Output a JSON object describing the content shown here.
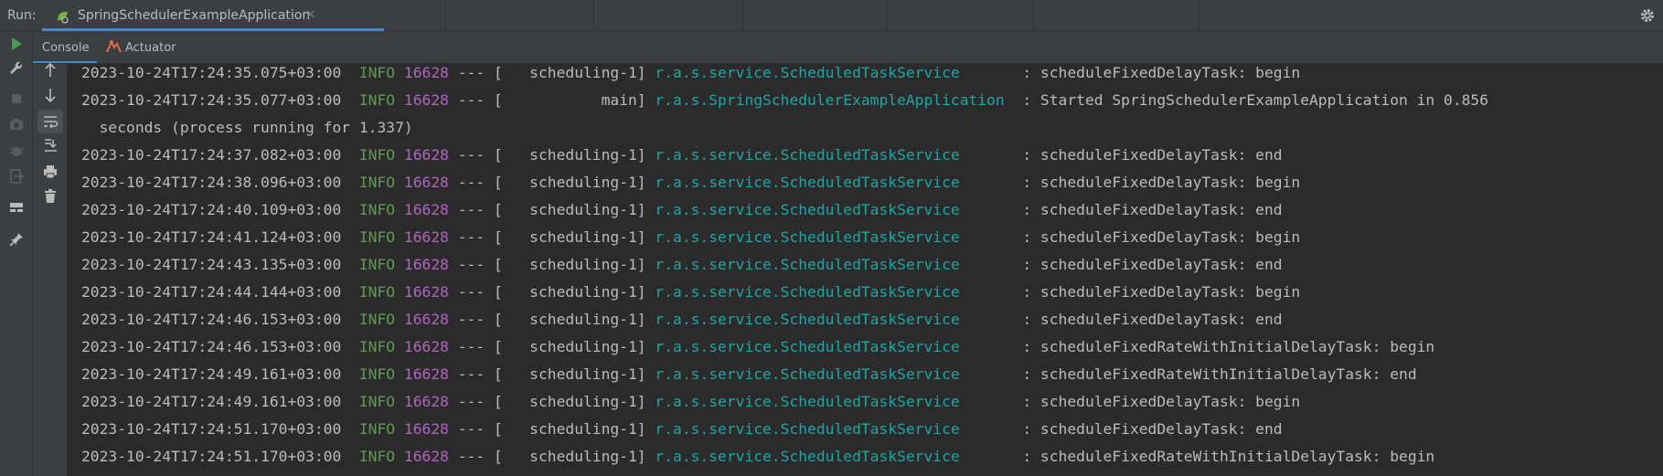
{
  "header": {
    "run_label": "Run:",
    "tab_title": "SpringSchedulerExampleApplication",
    "tab_close": "×"
  },
  "subtabs": [
    {
      "label": "Console",
      "active": true
    },
    {
      "label": "Actuator",
      "active": false
    }
  ],
  "colors": {
    "accent": "#4a88c7",
    "info": "#629755",
    "pid": "#b064c2",
    "logger": "#1fa5a5",
    "run_green": "#499c54"
  },
  "icons": {
    "left_toolbar": [
      "run-icon",
      "wrench-icon",
      "stop-icon",
      "camera-icon",
      "debug-bug-icon",
      "exit-icon",
      "layout-icon",
      "pin-icon"
    ],
    "console_toolbar": [
      "up-arrow-icon",
      "down-arrow-icon",
      "soft-wrap-icon",
      "scroll-to-end-icon",
      "print-icon",
      "trash-icon"
    ]
  },
  "log": [
    {
      "ts": "2023-10-24T17:24:35.075+03:00",
      "level": "INFO",
      "pid": "16628",
      "sep": "---",
      "thread": "[   scheduling-1]",
      "logger": "r.a.s.service.ScheduledTaskService      ",
      "msg": ": scheduleFixedDelayTask: begin"
    },
    {
      "ts": "2023-10-24T17:24:35.077+03:00",
      "level": "INFO",
      "pid": "16628",
      "sep": "---",
      "thread": "[           main]",
      "logger": "r.a.s.SpringSchedulerExampleApplication ",
      "msg": ": Started SpringSchedulerExampleApplication in 0.856"
    },
    {
      "continuation": "  seconds (process running for 1.337)"
    },
    {
      "ts": "2023-10-24T17:24:37.082+03:00",
      "level": "INFO",
      "pid": "16628",
      "sep": "---",
      "thread": "[   scheduling-1]",
      "logger": "r.a.s.service.ScheduledTaskService      ",
      "msg": ": scheduleFixedDelayTask: end"
    },
    {
      "ts": "2023-10-24T17:24:38.096+03:00",
      "level": "INFO",
      "pid": "16628",
      "sep": "---",
      "thread": "[   scheduling-1]",
      "logger": "r.a.s.service.ScheduledTaskService      ",
      "msg": ": scheduleFixedDelayTask: begin"
    },
    {
      "ts": "2023-10-24T17:24:40.109+03:00",
      "level": "INFO",
      "pid": "16628",
      "sep": "---",
      "thread": "[   scheduling-1]",
      "logger": "r.a.s.service.ScheduledTaskService      ",
      "msg": ": scheduleFixedDelayTask: end"
    },
    {
      "ts": "2023-10-24T17:24:41.124+03:00",
      "level": "INFO",
      "pid": "16628",
      "sep": "---",
      "thread": "[   scheduling-1]",
      "logger": "r.a.s.service.ScheduledTaskService      ",
      "msg": ": scheduleFixedDelayTask: begin"
    },
    {
      "ts": "2023-10-24T17:24:43.135+03:00",
      "level": "INFO",
      "pid": "16628",
      "sep": "---",
      "thread": "[   scheduling-1]",
      "logger": "r.a.s.service.ScheduledTaskService      ",
      "msg": ": scheduleFixedDelayTask: end"
    },
    {
      "ts": "2023-10-24T17:24:44.144+03:00",
      "level": "INFO",
      "pid": "16628",
      "sep": "---",
      "thread": "[   scheduling-1]",
      "logger": "r.a.s.service.ScheduledTaskService      ",
      "msg": ": scheduleFixedDelayTask: begin"
    },
    {
      "ts": "2023-10-24T17:24:46.153+03:00",
      "level": "INFO",
      "pid": "16628",
      "sep": "---",
      "thread": "[   scheduling-1]",
      "logger": "r.a.s.service.ScheduledTaskService      ",
      "msg": ": scheduleFixedDelayTask: end"
    },
    {
      "ts": "2023-10-24T17:24:46.153+03:00",
      "level": "INFO",
      "pid": "16628",
      "sep": "---",
      "thread": "[   scheduling-1]",
      "logger": "r.a.s.service.ScheduledTaskService      ",
      "msg": ": scheduleFixedRateWithInitialDelayTask: begin"
    },
    {
      "ts": "2023-10-24T17:24:49.161+03:00",
      "level": "INFO",
      "pid": "16628",
      "sep": "---",
      "thread": "[   scheduling-1]",
      "logger": "r.a.s.service.ScheduledTaskService      ",
      "msg": ": scheduleFixedRateWithInitialDelayTask: end"
    },
    {
      "ts": "2023-10-24T17:24:49.161+03:00",
      "level": "INFO",
      "pid": "16628",
      "sep": "---",
      "thread": "[   scheduling-1]",
      "logger": "r.a.s.service.ScheduledTaskService      ",
      "msg": ": scheduleFixedDelayTask: begin"
    },
    {
      "ts": "2023-10-24T17:24:51.170+03:00",
      "level": "INFO",
      "pid": "16628",
      "sep": "---",
      "thread": "[   scheduling-1]",
      "logger": "r.a.s.service.ScheduledTaskService      ",
      "msg": ": scheduleFixedDelayTask: end"
    },
    {
      "ts": "2023-10-24T17:24:51.170+03:00",
      "level": "INFO",
      "pid": "16628",
      "sep": "---",
      "thread": "[   scheduling-1]",
      "logger": "r.a.s.service.ScheduledTaskService      ",
      "msg": ": scheduleFixedRateWithInitialDelayTask: begin"
    }
  ]
}
